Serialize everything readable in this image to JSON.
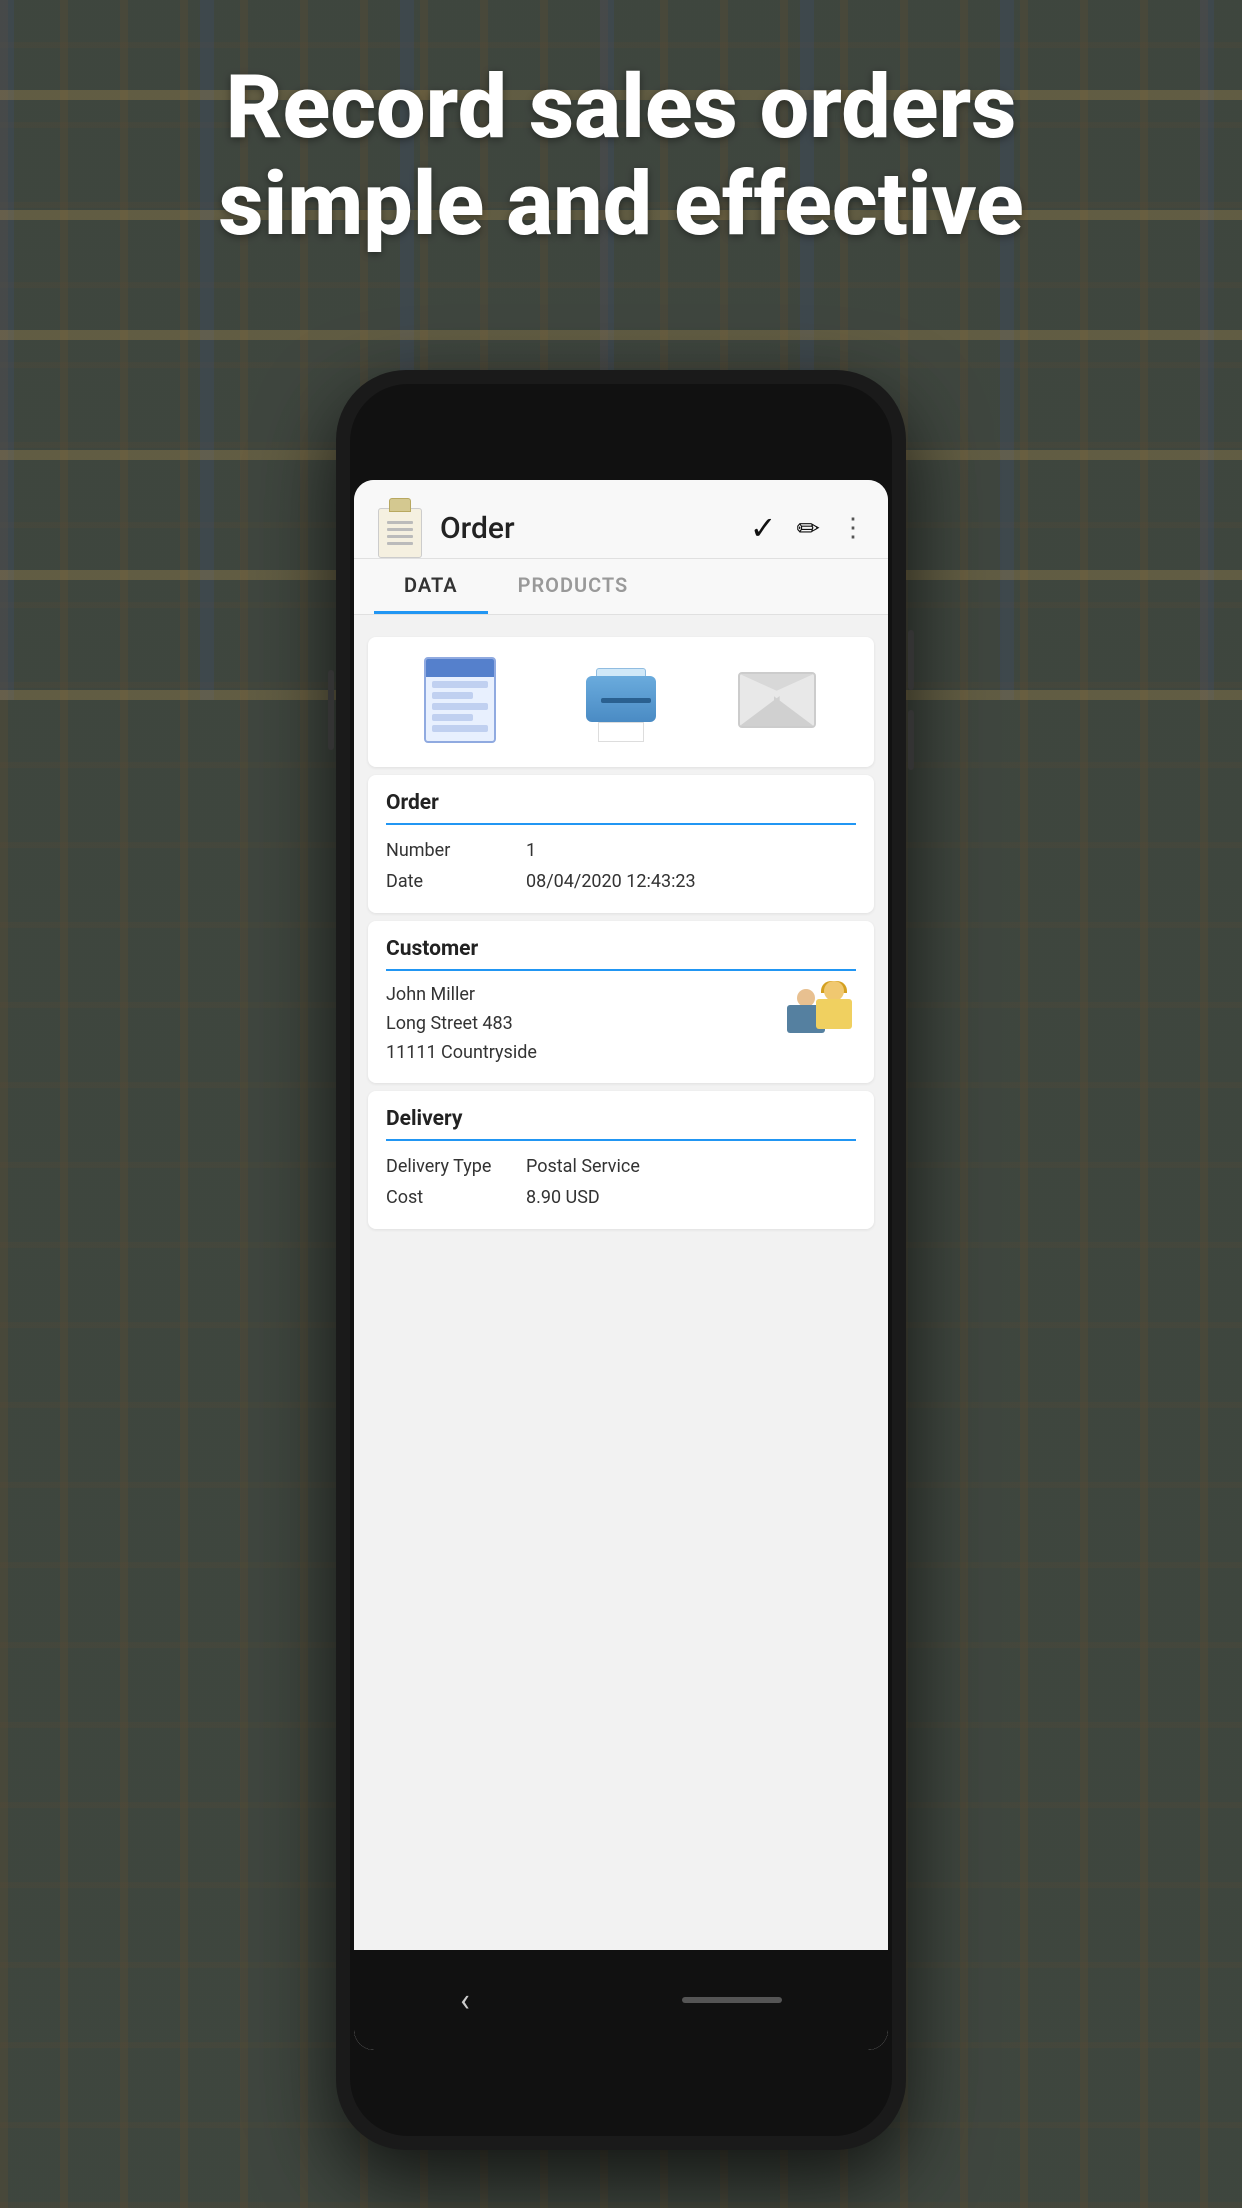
{
  "hero": {
    "line1": "Record sales orders",
    "line2": "simple and effective"
  },
  "app": {
    "title": "Order",
    "tabs": [
      {
        "id": "data",
        "label": "DATA",
        "active": true
      },
      {
        "id": "products",
        "label": "PRODUCTS",
        "active": false
      }
    ]
  },
  "actions": {
    "check": "✓",
    "edit": "✏",
    "more": "⋮"
  },
  "order_section": {
    "title": "Order",
    "fields": [
      {
        "label": "Number",
        "value": "1"
      },
      {
        "label": "Date",
        "value": "08/04/2020 12:43:23"
      }
    ]
  },
  "customer_section": {
    "title": "Customer",
    "name": "John Miller",
    "address_line1": "Long Street 483",
    "address_line2": "11111 Countryside"
  },
  "delivery_section": {
    "title": "Delivery",
    "fields": [
      {
        "label": "Delivery Type",
        "value": "Postal Service"
      },
      {
        "label": "Cost",
        "value": "8.90 USD"
      }
    ]
  },
  "icons": {
    "document": "document-icon",
    "printer": "printer-icon",
    "envelope": "envelope-icon"
  }
}
